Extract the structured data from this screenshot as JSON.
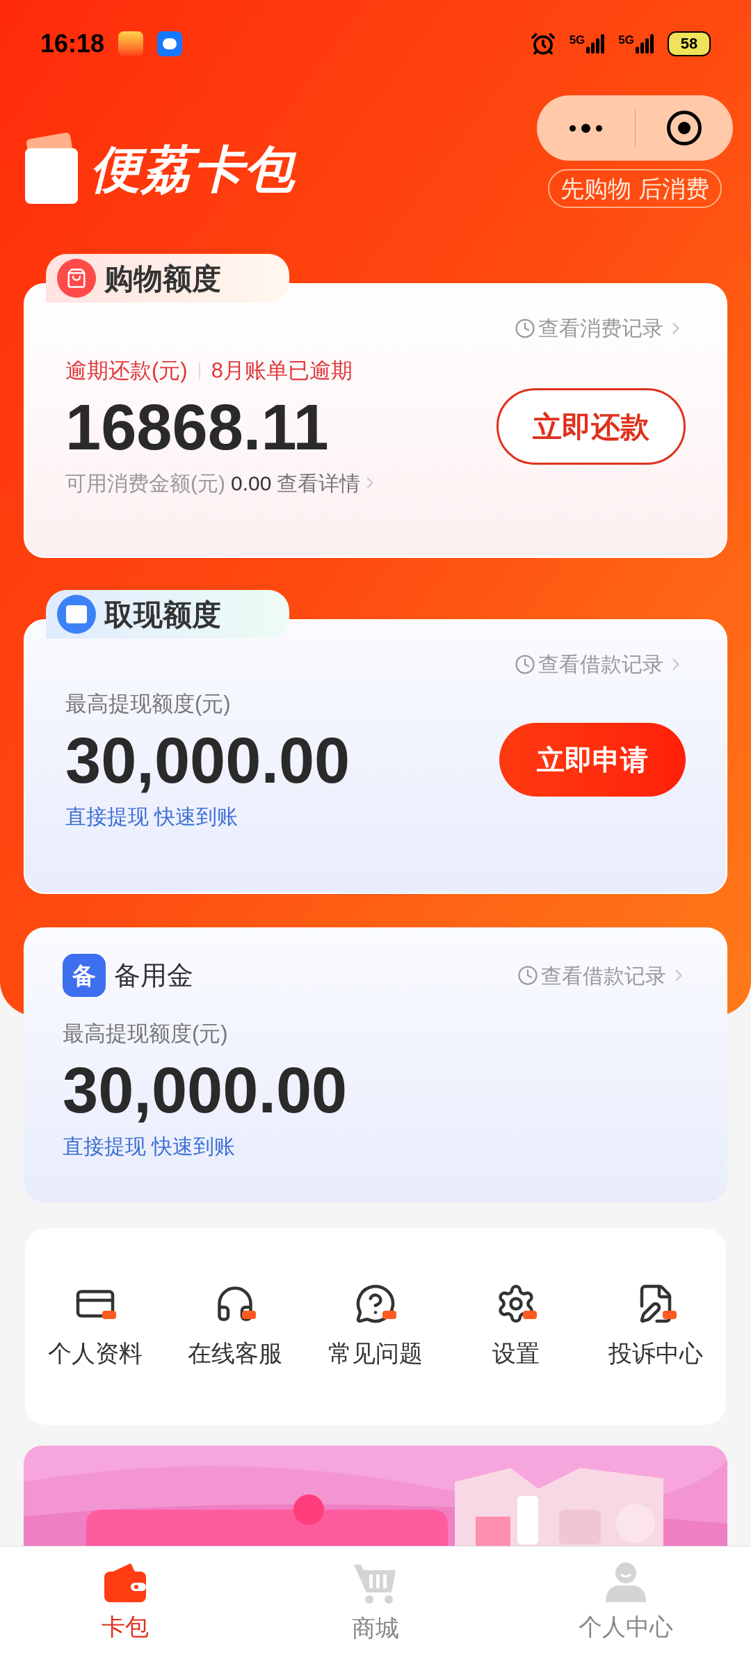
{
  "status_bar": {
    "time": "16:18",
    "network_1": "5G",
    "network_2": "5G",
    "battery": "58"
  },
  "header": {
    "logo_text": "便荔卡包",
    "slogan": "先购物 后消费"
  },
  "shopping_card": {
    "tab": "购物额度",
    "record_link": "查看消费记录",
    "overdue_label": "逾期还款(元)",
    "overdue_note": "8月账单已逾期",
    "amount": "16868.11",
    "available_label": "可用消费金额(元)",
    "available_value": "0.00",
    "detail_link": "查看详情",
    "button": "立即还款"
  },
  "cash_card": {
    "tab": "取现额度",
    "record_link": "查看借款记录",
    "label": "最高提现额度(元)",
    "amount": "30,000.00",
    "note": "直接提现 快速到账",
    "button": "立即申请"
  },
  "reserve_card": {
    "icon_char": "备",
    "title": "备用金",
    "record_link": "查看借款记录",
    "label": "最高提现额度(元)",
    "amount": "30,000.00",
    "note": "直接提现 快速到账"
  },
  "menu": [
    {
      "kind": "card",
      "label": "个人资料"
    },
    {
      "kind": "headset",
      "label": "在线客服"
    },
    {
      "kind": "question",
      "label": "常见问题"
    },
    {
      "kind": "gear",
      "label": "设置"
    },
    {
      "kind": "document",
      "label": "投诉中心"
    }
  ],
  "tab_bar": [
    {
      "kind": "wallet",
      "label": "卡包",
      "selected": true
    },
    {
      "kind": "cart",
      "label": "商城",
      "selected": false
    },
    {
      "kind": "person",
      "label": "个人中心",
      "selected": false
    }
  ]
}
